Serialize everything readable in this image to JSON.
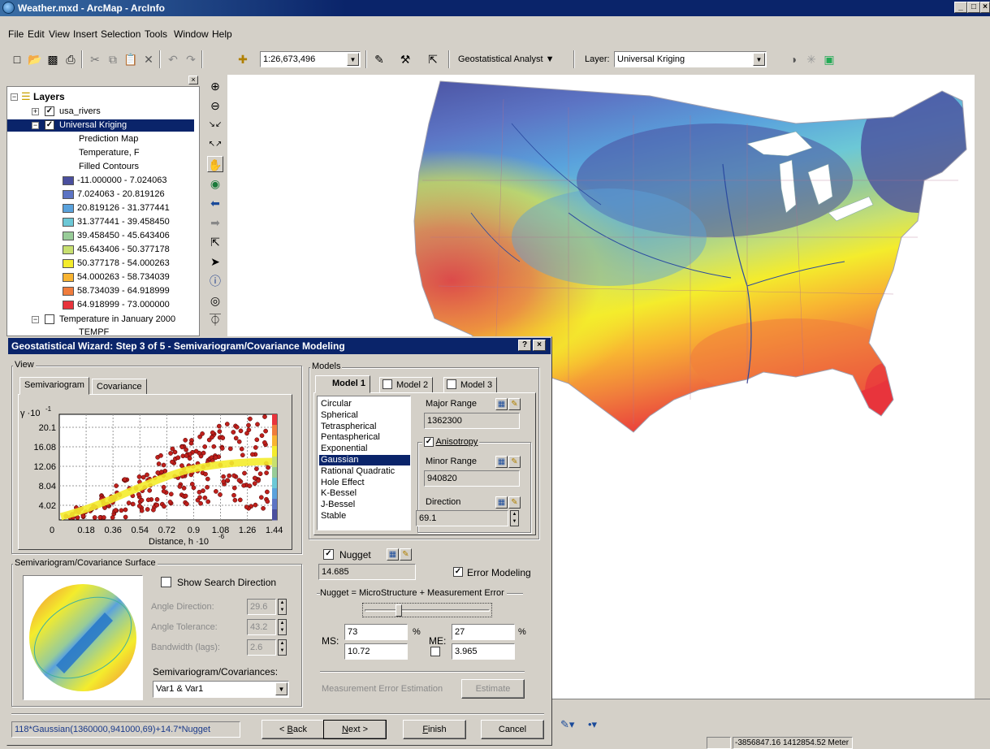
{
  "window": {
    "title": "Weather.mxd - ArcMap - ArcInfo",
    "caption_buttons": [
      "_",
      "□",
      "×"
    ]
  },
  "menu": [
    "File",
    "Edit",
    "View",
    "Insert",
    "Selection",
    "Tools",
    "Window",
    "Help"
  ],
  "toolbar": {
    "scale": "1:26,673,496",
    "geostat_label": "Geostatistical Analyst ▼",
    "layer_label": "Layer:",
    "layer_value": "Universal Kriging"
  },
  "toc": {
    "root": "Layers",
    "layers": [
      {
        "name": "usa_rivers",
        "checked": true
      },
      {
        "name": "Universal Kriging",
        "checked": true,
        "selected": true
      },
      {
        "name": "Temperature in January 2000",
        "checked": false
      }
    ],
    "sublabels": [
      "Prediction Map",
      "Temperature, F",
      "Filled Contours"
    ],
    "temperature_sub": "TEMPF",
    "legend": [
      {
        "label": "-11.000000 - 7.024063",
        "color": "#4a4f9e"
      },
      {
        "label": "7.024063 - 20.819126",
        "color": "#5c74c4"
      },
      {
        "label": "20.819126 - 31.377441",
        "color": "#5aa2dc"
      },
      {
        "label": "31.377441 - 39.458450",
        "color": "#6cc8d6"
      },
      {
        "label": "39.458450 - 45.643406",
        "color": "#98cc98"
      },
      {
        "label": "45.643406 - 50.377178",
        "color": "#c8e070"
      },
      {
        "label": "50.377178 - 54.000263",
        "color": "#f4ec2c"
      },
      {
        "label": "54.000263 - 58.734039",
        "color": "#f8b432"
      },
      {
        "label": "58.734039 - 64.918999",
        "color": "#f07c3c"
      },
      {
        "label": "64.918999 - 73.000000",
        "color": "#e8343c"
      }
    ]
  },
  "dialog": {
    "title": "Geostatistical Wizard: Step 3 of 5 - Semivariogram/Covariance Modeling",
    "view_group": "View",
    "tabs": [
      "Semivariogram",
      "Covariance"
    ],
    "plot": {
      "y_label": "γ ·10",
      "y_exp": "-1",
      "y_ticks": [
        "20.1",
        "16.08",
        "12.06",
        "8.04",
        "4.02",
        "0"
      ],
      "x_ticks": [
        "0.18",
        "0.36",
        "0.54",
        "0.72",
        "0.9",
        "1.08",
        "1.26",
        "1.44"
      ],
      "x_label": "Distance, h ·10",
      "x_exp": "-6"
    },
    "surface_group": "Semivariogram/Covariance Surface",
    "show_search": "Show Search Direction",
    "angle_direction_label": "Angle Direction:",
    "angle_direction": "29.6",
    "angle_tolerance_label": "Angle Tolerance:",
    "angle_tolerance": "43.2",
    "bandwidth_label": "Bandwidth (lags):",
    "bandwidth": "2.6",
    "semivariogram_covariances_label": "Semivariogram/Covariances:",
    "semivariogram_covariances_value": "Var1 & Var1",
    "models_group": "Models",
    "model_tabs": [
      "Model 1",
      "Model 2",
      "Model 3"
    ],
    "model_types": [
      "Circular",
      "Spherical",
      "Tetraspherical",
      "Pentaspherical",
      "Exponential",
      "Gaussian",
      "Rational Quadratic",
      "Hole Effect",
      "K-Bessel",
      "J-Bessel",
      "Stable"
    ],
    "selected_model": "Gaussian",
    "major_range_label": "Major Range",
    "major_range": "1362300",
    "anisotropy_label": "Anisotropy",
    "minor_range_label": "Minor Range",
    "minor_range": "940820",
    "direction_label": "Direction",
    "direction": "69.1",
    "nugget_label": "Nugget",
    "nugget": "14.685",
    "error_modeling_label": "Error Modeling",
    "nugget_formula": "Nugget = MicroStructure + Measurement Error",
    "ms_label": "MS:",
    "ms_pct": "73",
    "ms_value": "10.72",
    "me_label": "ME:",
    "me_pct": "27",
    "me_value": "3.965",
    "pct_symbol": "%",
    "measurement_error_estimation": "Measurement Error Estimation",
    "estimate_button": "Estimate",
    "formula": "118*Gaussian(1360000,941000,69)+14.7*Nugget",
    "buttons": {
      "back": "< Back",
      "next": "Next >",
      "finish": "Finish",
      "cancel": "Cancel"
    },
    "help_button": "?",
    "close_button": "×"
  },
  "status": {
    "coords": "-3856847.16  1412854.52 Meter"
  },
  "colors": {
    "title_bar": "#0a246a",
    "selection": "#0a246a",
    "scatter_point": "#c0201c",
    "model_curve": "#f4ec2c"
  }
}
